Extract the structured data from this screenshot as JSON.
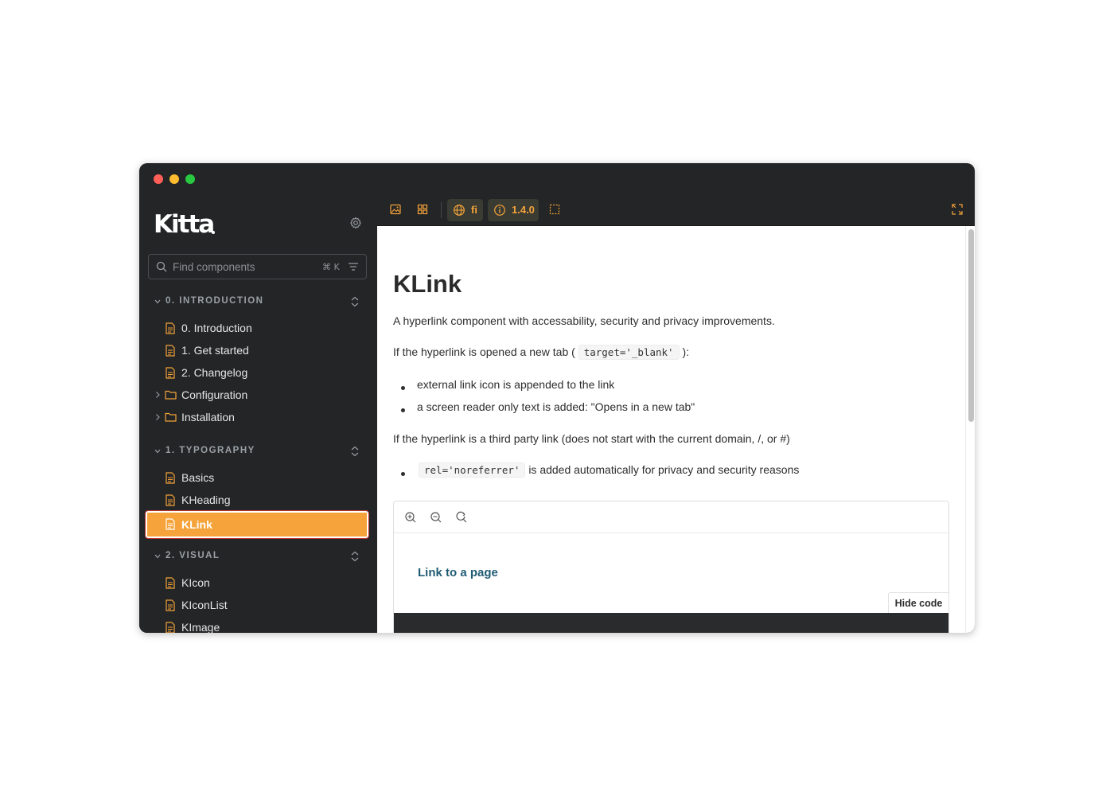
{
  "app": {
    "logo": "Kitta"
  },
  "search": {
    "placeholder": "Find components",
    "shortcut": "⌘ K"
  },
  "sidebar": {
    "groups": [
      {
        "title": "0. INTRODUCTION",
        "items": [
          {
            "label": "0. Introduction",
            "type": "doc"
          },
          {
            "label": "1. Get started",
            "type": "doc"
          },
          {
            "label": "2. Changelog",
            "type": "doc"
          },
          {
            "label": "Configuration",
            "type": "folder"
          },
          {
            "label": "Installation",
            "type": "folder"
          }
        ]
      },
      {
        "title": "1. TYPOGRAPHY",
        "items": [
          {
            "label": "Basics",
            "type": "doc"
          },
          {
            "label": "KHeading",
            "type": "doc"
          },
          {
            "label": "KLink",
            "type": "doc",
            "active": true
          }
        ]
      },
      {
        "title": "2. VISUAL",
        "items": [
          {
            "label": "KIcon",
            "type": "doc"
          },
          {
            "label": "KIconList",
            "type": "doc"
          },
          {
            "label": "KImage",
            "type": "doc"
          }
        ]
      }
    ]
  },
  "toolbar": {
    "locale": "fi",
    "version": "1.4.0"
  },
  "doc": {
    "title": "KLink",
    "intro": "A hyperlink component with accessability, security and privacy improvements.",
    "new_tab_prefix": "If the hyperlink is opened a new tab (",
    "new_tab_code": "target='_blank'",
    "new_tab_suffix": "):",
    "bullets_new_tab": [
      "external link icon is appended to the link",
      "a screen reader only text is added: \"Opens in a new tab\""
    ],
    "third_party": "If the hyperlink is a third party link (does not start with the current domain, /, or #)",
    "rel_code": "rel='noreferrer'",
    "rel_suffix": "is added automatically for privacy and security reasons"
  },
  "canvas": {
    "story_link": "Link to a page",
    "hide_code_label": "Hide code"
  },
  "colors": {
    "accent": "#f5a33a",
    "sidebar_bg": "#232526",
    "link": "#1f5b73"
  }
}
